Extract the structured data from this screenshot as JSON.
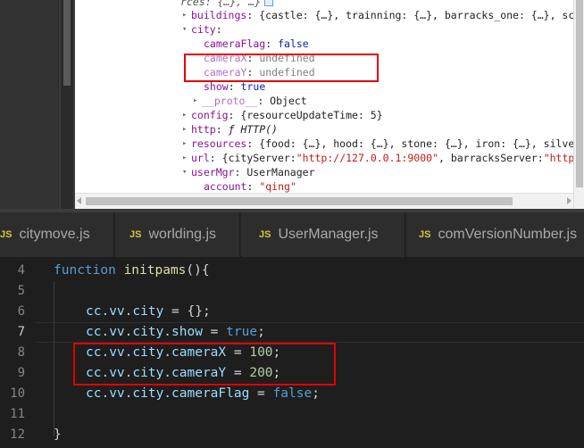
{
  "devtools": {
    "tree": [
      {
        "text_key": "rces: {…}, …}",
        "kind": "cut"
      },
      {
        "toggle": "▸",
        "key": "buildings",
        "value": "{castle: {…}, trainning: {…}, barracks_one: {…}, schoo"
      },
      {
        "toggle": "▾",
        "key": "city",
        "value": ""
      },
      {
        "key": "cameraFlag",
        "value": "false"
      },
      {
        "key": "cameraX",
        "value": "undefined"
      },
      {
        "key": "cameraY",
        "value": "undefined"
      },
      {
        "key": "show",
        "value": "true"
      },
      {
        "toggle": "▸",
        "key": "__proto__",
        "value": "Object"
      },
      {
        "toggle": "▸",
        "key": "config",
        "value": "{resourceUpdateTime: 5}"
      },
      {
        "toggle": "▸",
        "key": "http",
        "value_prefix": "ƒ",
        "value": "HTTP()"
      },
      {
        "toggle": "▸",
        "key": "resources",
        "value": "{food: {…}, hood: {…}, stone: {…}, iron: {…}, silver:"
      },
      {
        "toggle": "▸",
        "key": "url",
        "value_pre": "{cityServer: ",
        "value_str1": "\"http://127.0.0.1:9000\"",
        "value_mid": ", barracksServer: ",
        "value_str2": "\"http:"
      },
      {
        "toggle": "▾",
        "key": "userMgr",
        "value": "UserManager"
      },
      {
        "key": "account",
        "value": "\"qing\""
      }
    ]
  },
  "tabs": [
    {
      "icon": "JS",
      "label": "citymove.js"
    },
    {
      "icon": "JS",
      "label": "worlding.js"
    },
    {
      "icon": "JS",
      "label": "UserManager.js"
    },
    {
      "icon": "JS",
      "label": "comVersionNumber.js"
    }
  ],
  "editor": {
    "line_numbers": [
      "4",
      "5",
      "6",
      "7",
      "8",
      "9",
      "10",
      "11",
      "12"
    ],
    "active_line": "7",
    "code": {
      "l4_kw": "function",
      "l4_fn": "initpams",
      "l4_rest": "(){",
      "l6_obj": "cc.vv.city",
      "l6_rest": " = {};",
      "l7_obj": "cc.vv.city.show",
      "l7_eq": " = ",
      "l7_val": "true",
      "l7_end": ";",
      "l8_obj": "cc.vv.city.cameraX",
      "l8_eq": " = ",
      "l8_val": "100",
      "l8_end": ";",
      "l9_obj": "cc.vv.city.cameraY",
      "l9_eq": " = ",
      "l9_val": "200",
      "l9_end": ";",
      "l10_obj": "cc.vv.city.cameraFlag",
      "l10_eq": " = ",
      "l10_val": "false",
      "l10_end": ";",
      "l12": "}"
    }
  },
  "colors": {
    "highlight_box": "#e30000",
    "editor_bg": "#1e1e1e",
    "keyword": "#569cd6",
    "function": "#dcdcaa",
    "number": "#b5cea8"
  }
}
